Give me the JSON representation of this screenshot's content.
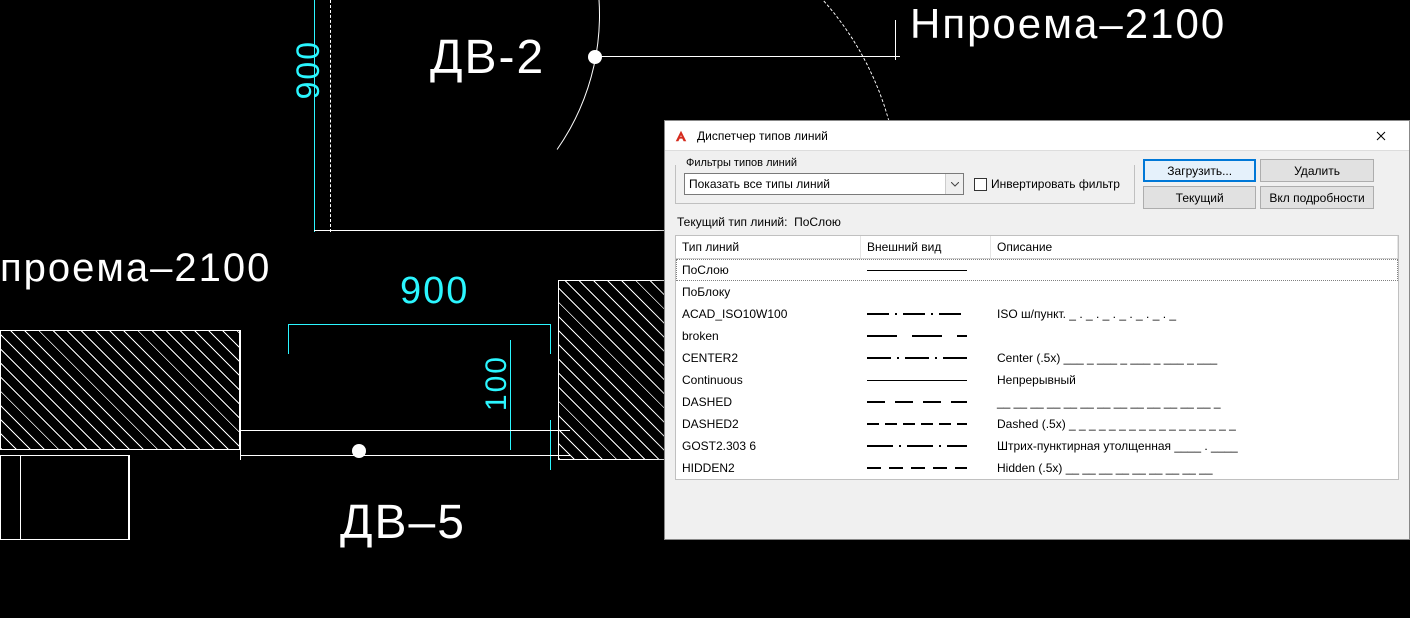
{
  "cad": {
    "label_dv2": "ДВ-2",
    "label_dv5": "ДВ–5",
    "label_h1": "Нпроема–2100",
    "label_h2": "проема–2100",
    "dim_900_a": "900",
    "dim_900_b": "900",
    "dim_100": "100"
  },
  "dialog": {
    "title": "Диспетчер типов линий",
    "filters_label": "Фильтры типов линий",
    "dropdown_value": "Показать все типы линий",
    "invert_label": "Инвертировать фильтр",
    "btn_load": "Загрузить...",
    "btn_delete": "Удалить",
    "btn_current": "Текущий",
    "btn_details": "Вкл подробности",
    "current_prefix": "Текущий тип линий:",
    "current_value": "ПоСлою",
    "columns": {
      "c1": "Тип линий",
      "c2": "Внешний вид",
      "c3": "Описание"
    },
    "rows": [
      {
        "name": "ПоСлою",
        "sample": "solid",
        "desc": "",
        "selected": true
      },
      {
        "name": "ПоБлоку",
        "sample": "",
        "desc": ""
      },
      {
        "name": "ACAD_ISO10W100",
        "sample": "iso",
        "desc": "ISO ш/пункт. _ . _ . _ . _ . _ . _ . _"
      },
      {
        "name": "broken",
        "sample": "broken",
        "desc": ""
      },
      {
        "name": "CENTER2",
        "sample": "center2",
        "desc": "Center (.5x) ___ _ ___ _ ___ _ ___ _ ___"
      },
      {
        "name": "Continuous",
        "sample": "solid",
        "desc": "Непрерывный"
      },
      {
        "name": "DASHED",
        "sample": "dashed",
        "desc": "__ __ __ __ __ __ __ __ __ __ __ __ __ _"
      },
      {
        "name": "DASHED2",
        "sample": "dashed2",
        "desc": "Dashed (.5x) _ _ _ _ _ _ _ _ _ _ _ _ _ _ _ _ _"
      },
      {
        "name": "GOST2.303 6",
        "sample": "gost",
        "desc": "Штрих-пунктирная утолщенная ____ . ____"
      },
      {
        "name": "HIDDEN2",
        "sample": "hidden2",
        "desc": "Hidden (.5x) __ __ __ __ __ __ __ __ __"
      }
    ]
  }
}
